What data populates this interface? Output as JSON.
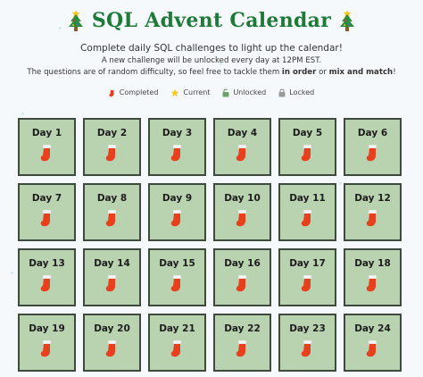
{
  "header": {
    "title": "SQL Advent Calendar"
  },
  "intro": {
    "line1": "Complete daily SQL challenges to light up the calendar!",
    "line2": "A new challenge will be unlocked every day at 12PM EST.",
    "line3_prefix": "The questions are of random difficulty, so feel free to tackle them ",
    "line3_bold1": "in order",
    "line3_mid": " or ",
    "line3_bold2": "mix and match",
    "line3_suffix": "!"
  },
  "legend": {
    "completed": "Completed",
    "current": "Current",
    "unlocked": "Unlocked",
    "locked": "Locked"
  },
  "days": [
    {
      "label": "Day 1",
      "status": "completed"
    },
    {
      "label": "Day 2",
      "status": "completed"
    },
    {
      "label": "Day 3",
      "status": "completed"
    },
    {
      "label": "Day 4",
      "status": "completed"
    },
    {
      "label": "Day 5",
      "status": "completed"
    },
    {
      "label": "Day 6",
      "status": "completed"
    },
    {
      "label": "Day 7",
      "status": "completed"
    },
    {
      "label": "Day 8",
      "status": "completed"
    },
    {
      "label": "Day 9",
      "status": "completed"
    },
    {
      "label": "Day 10",
      "status": "completed"
    },
    {
      "label": "Day 11",
      "status": "completed"
    },
    {
      "label": "Day 12",
      "status": "completed"
    },
    {
      "label": "Day 13",
      "status": "completed"
    },
    {
      "label": "Day 14",
      "status": "completed"
    },
    {
      "label": "Day 15",
      "status": "completed"
    },
    {
      "label": "Day 16",
      "status": "completed"
    },
    {
      "label": "Day 17",
      "status": "completed"
    },
    {
      "label": "Day 18",
      "status": "completed"
    },
    {
      "label": "Day 19",
      "status": "completed"
    },
    {
      "label": "Day 20",
      "status": "completed"
    },
    {
      "label": "Day 21",
      "status": "completed"
    },
    {
      "label": "Day 22",
      "status": "completed"
    },
    {
      "label": "Day 23",
      "status": "completed"
    },
    {
      "label": "Day 24",
      "status": "completed"
    }
  ],
  "colors": {
    "title": "#1f7a3a",
    "card_bg": "#b9d3b0",
    "card_border": "#3f4a3e",
    "stocking_red": "#e8401c",
    "stocking_cuff": "#f4f4f4"
  }
}
